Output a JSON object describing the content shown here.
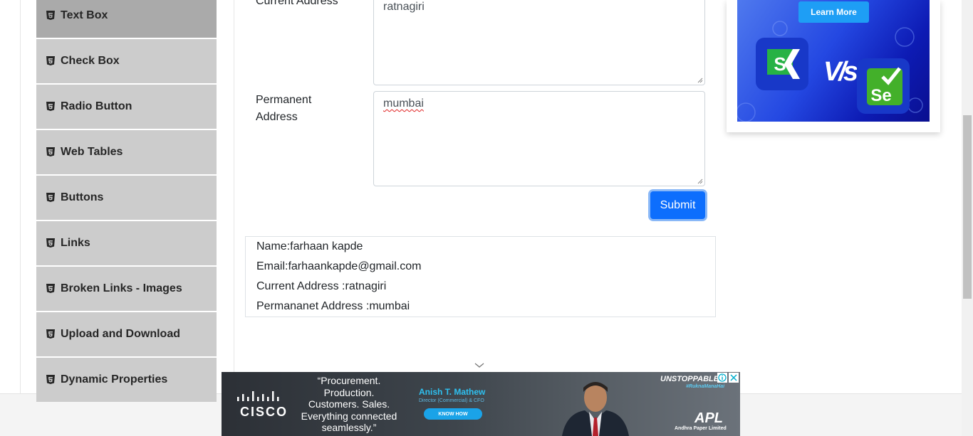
{
  "sidebar": {
    "items": [
      {
        "label": "Text Box",
        "active": true
      },
      {
        "label": "Check Box"
      },
      {
        "label": "Radio Button"
      },
      {
        "label": "Web Tables"
      },
      {
        "label": "Buttons"
      },
      {
        "label": "Links"
      },
      {
        "label": "Broken Links - Images"
      },
      {
        "label": "Upload and Download"
      },
      {
        "label": "Dynamic Properties"
      }
    ],
    "item_icon": "html5-icon",
    "active_color": "#aaaaaa",
    "item_color": "#cccccc"
  },
  "form": {
    "current_address_label": "Current Address",
    "current_address_value": "ratnagiri",
    "permanent_address_label_line1": "Permanent",
    "permanent_address_label_line2": "Address",
    "permanent_address_value": "mumbai",
    "submit_label": "Submit",
    "submit_color": "#0d6efd"
  },
  "output": {
    "name": "Name:farhaan kapde",
    "email": "Email:farhaankapde@gmail.com",
    "current_address": "Current Address :ratnagiri",
    "permanent_address": "Permananet Address :mumbai"
  },
  "ad_top": {
    "button": "Learn More",
    "vs_text": "V/s",
    "left_logo": "S",
    "right_logo": "Se"
  },
  "ad_bottom": {
    "brand": "CISCO",
    "quote_lines": [
      "“Procurement.",
      "Production.",
      "Customers. Sales.",
      "Everything connected",
      "seamlessly.”"
    ],
    "person_name": "Anish T. Mathew",
    "person_title": "Director (Commercial) & CFO",
    "cta": "KNOW HOW",
    "campaign": "UNSTOPPABLE",
    "hashtag": "#RuknaManaHai",
    "company_logo": "APL",
    "company_name": "Andhra Paper Limited"
  }
}
